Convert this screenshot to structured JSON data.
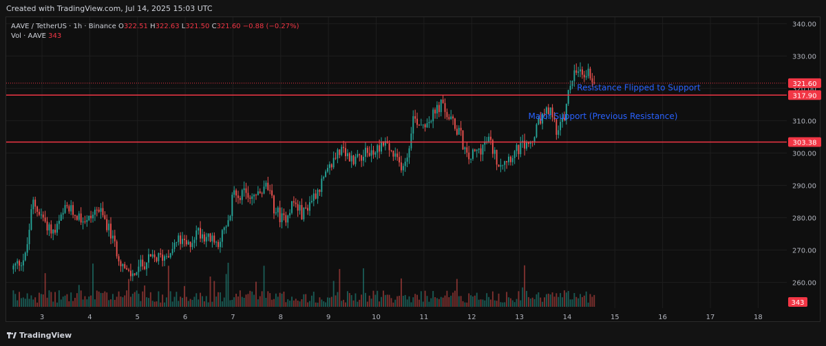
{
  "header": {
    "created": "Created with TradingView.com, Jul 14, 2025 15:03 UTC"
  },
  "legend": {
    "symbol": "AAVE / TetherUS · 1h · Binance",
    "open_label": "O",
    "open": "322.51",
    "high_label": "H",
    "high": "322.63",
    "low_label": "L",
    "low": "321.50",
    "close_label": "C",
    "close": "321.60",
    "change": "−0.88 (−0.27%)",
    "vol_label": "Vol · AAVE",
    "vol_value": "343"
  },
  "footer": {
    "brand": "TradingView"
  },
  "colors": {
    "up": "#26a69a",
    "down": "#ef5350",
    "level": "#f23645",
    "annotation": "#2962ff",
    "bg": "#0f0f0f",
    "grid": "#1e1e1e"
  },
  "chart_data": {
    "type": "candlestick",
    "symbol": "AAVE / TetherUS",
    "interval": "1h",
    "exchange": "Binance",
    "y_ticks": [
      340,
      330,
      320,
      310,
      300,
      290,
      280,
      270,
      260
    ],
    "ylim": [
      252,
      342
    ],
    "x_ticks": [
      "3",
      "4",
      "5",
      "6",
      "7",
      "8",
      "9",
      "10",
      "11",
      "12",
      "13",
      "14",
      "15",
      "16",
      "17",
      "18"
    ],
    "x_range_days": [
      2.25,
      18.6
    ],
    "horizontal_levels": [
      {
        "price": 317.9,
        "label": "317.90",
        "style": "solid"
      },
      {
        "price": 303.38,
        "label": "303.38",
        "style": "solid"
      },
      {
        "price": 321.6,
        "label": "321.60",
        "style": "dotted",
        "type": "last-price"
      }
    ],
    "annotations": [
      {
        "text": "Resistance Flipped to Support",
        "day": 15.5,
        "price": 319.3
      },
      {
        "text": "Major Support (Previous Resistance)",
        "day": 14.75,
        "price": 310.5
      }
    ],
    "volume_last": "343",
    "price_path": [
      [
        2.4,
        264
      ],
      [
        2.7,
        268
      ],
      [
        2.85,
        285
      ],
      [
        3.1,
        279
      ],
      [
        3.3,
        275
      ],
      [
        3.55,
        283
      ],
      [
        3.75,
        281
      ],
      [
        4.0,
        279
      ],
      [
        4.2,
        283
      ],
      [
        4.4,
        278
      ],
      [
        4.6,
        270
      ],
      [
        4.8,
        263
      ],
      [
        4.9,
        262
      ],
      [
        5.1,
        265
      ],
      [
        5.3,
        267
      ],
      [
        5.6,
        268
      ],
      [
        5.9,
        273
      ],
      [
        6.1,
        271
      ],
      [
        6.3,
        276
      ],
      [
        6.5,
        274
      ],
      [
        6.7,
        272
      ],
      [
        6.95,
        278
      ],
      [
        7.05,
        288
      ],
      [
        7.3,
        287
      ],
      [
        7.6,
        287
      ],
      [
        7.75,
        290
      ],
      [
        7.9,
        283
      ],
      [
        8.1,
        279
      ],
      [
        8.3,
        285
      ],
      [
        8.5,
        281
      ],
      [
        8.7,
        286
      ],
      [
        9.0,
        293
      ],
      [
        9.25,
        301
      ],
      [
        9.5,
        298
      ],
      [
        9.8,
        300
      ],
      [
        10.0,
        300
      ],
      [
        10.2,
        304
      ],
      [
        10.4,
        299
      ],
      [
        10.55,
        296
      ],
      [
        10.7,
        299
      ],
      [
        10.8,
        311
      ],
      [
        11.0,
        309
      ],
      [
        11.2,
        311
      ],
      [
        11.4,
        315
      ],
      [
        11.6,
        310
      ],
      [
        11.8,
        306
      ],
      [
        11.95,
        298
      ],
      [
        12.2,
        301
      ],
      [
        12.4,
        304
      ],
      [
        12.6,
        297
      ],
      [
        12.85,
        299
      ],
      [
        13.1,
        302
      ],
      [
        13.3,
        303
      ],
      [
        13.5,
        311
      ],
      [
        13.7,
        313
      ],
      [
        13.85,
        306
      ],
      [
        14.0,
        312
      ],
      [
        14.1,
        321
      ],
      [
        14.2,
        325
      ],
      [
        14.35,
        324
      ],
      [
        14.5,
        325
      ],
      [
        14.62,
        322
      ]
    ]
  }
}
